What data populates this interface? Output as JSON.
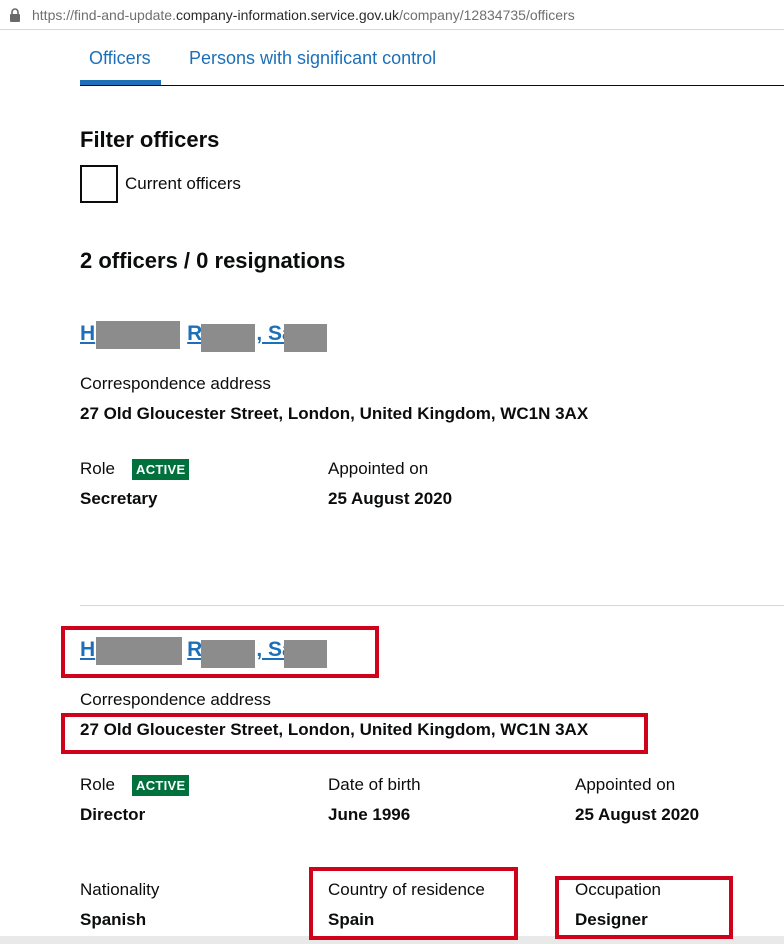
{
  "browser": {
    "url_prefix": "https://find-and-update.",
    "url_host": "company-information.service.gov.uk",
    "url_path": "/company/12834735/officers",
    "lock_icon": "lock-icon"
  },
  "tabs": [
    {
      "label": "Officers",
      "active": true
    },
    {
      "label": "Persons with significant control",
      "active": false
    }
  ],
  "filter": {
    "heading": "Filter officers",
    "checkbox_label": "Current officers",
    "checked": false
  },
  "summary": "2 officers / 0 resignations",
  "officers": [
    {
      "name_parts": [
        "H",
        "R",
        ", Sa"
      ],
      "address_label": "Correspondence address",
      "address": "27 Old Gloucester Street, London, United Kingdom, WC1N 3AX",
      "role_label": "Role",
      "status": "ACTIVE",
      "role": "Secretary",
      "appointed_label": "Appointed on",
      "appointed": "25 August 2020"
    },
    {
      "name_parts": [
        "H",
        "R",
        ", Sa"
      ],
      "address_label": "Correspondence address",
      "address": "27 Old Gloucester Street, London, United Kingdom, WC1N 3AX",
      "role_label": "Role",
      "status": "ACTIVE",
      "role": "Director",
      "dob_label": "Date of birth",
      "dob": "June 1996",
      "appointed_label": "Appointed on",
      "appointed": "25 August 2020",
      "nationality_label": "Nationality",
      "nationality": "Spanish",
      "residence_label": "Country of residence",
      "residence": "Spain",
      "occupation_label": "Occupation",
      "occupation": "Designer"
    }
  ],
  "colors": {
    "link": "#1d70b8",
    "active_badge": "#00703c",
    "highlight": "#d0021b",
    "redaction": "#8c8c8c"
  }
}
